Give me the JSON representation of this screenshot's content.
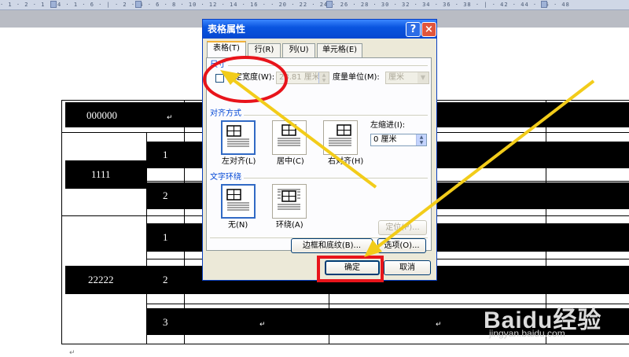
{
  "ruler": {
    "ticks": "· 1 · 2 · 1 · 4 · 1 · 6 · | ·  2  ·  4  ·  6  ·  8  · 10 · 12 · 14 · 16 ·  · 20 · 22 · 24 · 26 · 28 · 30 · 32 · 34 · 36 · 38 · | · 42 · 44 · 46 · 48"
  },
  "document": {
    "row_labels": [
      "000000",
      "1111",
      "22222"
    ],
    "sub_numbers": [
      "1",
      "2",
      "1",
      "2",
      "3"
    ],
    "para_mark": "↵"
  },
  "dialog": {
    "title": "表格属性",
    "help": "?",
    "close": "×",
    "tabs": [
      "表格(T)",
      "行(R)",
      "列(U)",
      "单元格(E)"
    ],
    "size_section": "尺寸",
    "specify_width": "指定宽度(W):",
    "width_value": "23.81 厘米",
    "measure_unit_label": "度量单位(M):",
    "measure_unit_value": "厘米",
    "align_section": "对齐方式",
    "align_left": "左对齐(L)",
    "align_center": "居中(C)",
    "align_right": "右对齐(H)",
    "indent_label": "左缩进(I):",
    "indent_value": "0 厘米",
    "wrap_section": "文字环绕",
    "wrap_none": "无(N)",
    "wrap_around": "环绕(A)",
    "position_btn": "定位(P)...",
    "borders_btn": "边框和底纹(B)...",
    "options_btn": "选项(O)...",
    "ok_btn": "确定",
    "cancel_btn": "取消"
  },
  "watermark": {
    "logo": "Baidu经验",
    "url": "jingyan.baidu.com"
  },
  "colors": {
    "annotation_red": "#e8141b",
    "annotation_yellow": "#f2cc1a",
    "dialog_face": "#ece9d8",
    "title_blue": "#0a55e0"
  }
}
